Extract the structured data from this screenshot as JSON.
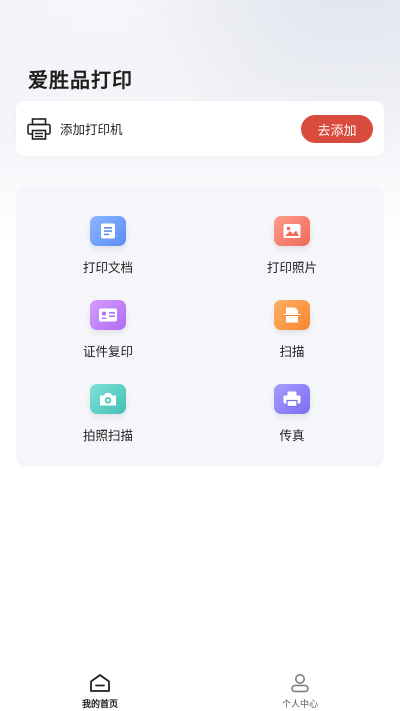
{
  "header": {
    "title": "爱胜品打印"
  },
  "printer": {
    "label": "添加打印机",
    "add_button": "去添加"
  },
  "functions": [
    {
      "label": "打印文档",
      "icon": "document-icon",
      "color_from": "#8ab6ff",
      "color_to": "#5b8ef5"
    },
    {
      "label": "打印照片",
      "icon": "photo-icon",
      "color_from": "#ff9a8a",
      "color_to": "#ef6a5a"
    },
    {
      "label": "证件复印",
      "icon": "id-card-icon",
      "color_from": "#d59cff",
      "color_to": "#b06cf2"
    },
    {
      "label": "扫描",
      "icon": "scan-icon",
      "color_from": "#ffb066",
      "color_to": "#f4862e"
    },
    {
      "label": "拍照扫描",
      "icon": "camera-icon",
      "color_from": "#7fe0d8",
      "color_to": "#43c0b5"
    },
    {
      "label": "传真",
      "icon": "fax-icon",
      "color_from": "#a79cff",
      "color_to": "#7d6df2"
    }
  ],
  "tabbar": {
    "home_label": "我的首页",
    "profile_label": "个人中心",
    "active_color": "#222222",
    "inactive_color": "#555555"
  }
}
